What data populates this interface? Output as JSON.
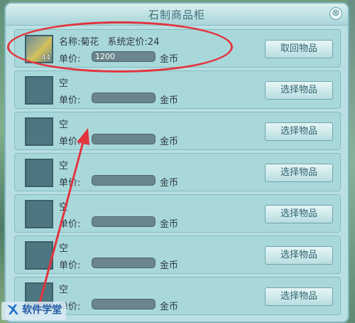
{
  "window": {
    "title": "石制商品柜",
    "close_symbol": "⊗"
  },
  "slots": [
    {
      "name_label": "名称:菊花",
      "system_price_label": "系统定价:24",
      "price_label": "单价:",
      "price_value": "1200",
      "currency": "金币",
      "button": "取回物品",
      "quantity": "44"
    },
    {
      "name_label": "空",
      "price_label": "单价:",
      "price_value": "",
      "currency": "金币",
      "button": "选择物品"
    },
    {
      "name_label": "空",
      "price_label": "单价:",
      "price_value": "",
      "currency": "金币",
      "button": "选择物品"
    },
    {
      "name_label": "空",
      "price_label": "单价:",
      "price_value": "",
      "currency": "金币",
      "button": "选择物品"
    },
    {
      "name_label": "空",
      "price_label": "单价:",
      "price_value": "",
      "currency": "金币",
      "button": "选择物品"
    },
    {
      "name_label": "空",
      "price_label": "单价:",
      "price_value": "",
      "currency": "金币",
      "button": "选择物品"
    },
    {
      "name_label": "空",
      "price_label": "单价:",
      "price_value": "",
      "currency": "金币",
      "button": "选择物品"
    }
  ],
  "watermark": {
    "text": "软件学堂",
    "icon": "logo-icon"
  },
  "annotation": {
    "color": "#e2343d"
  }
}
